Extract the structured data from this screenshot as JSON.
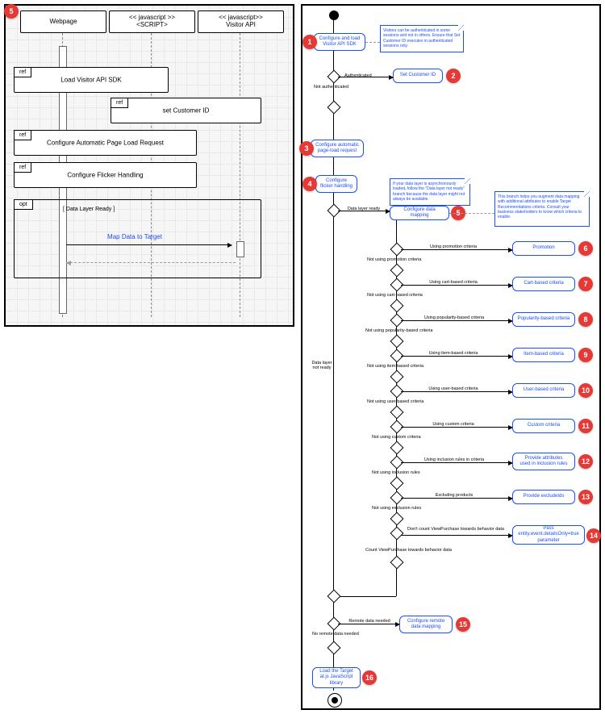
{
  "sequence": {
    "corner_marker": "5",
    "lanes": {
      "webpage": "Webpage",
      "script": "<< javascript >>\n<SCRIPT>",
      "visitor": "<< javascript>>\nVisitor API"
    },
    "frag_ref1": "ref",
    "frag_ref1_label": "Load Visitor API SDK",
    "frag_ref2": "ref",
    "frag_ref2_label": "set Customer ID",
    "frag_ref3": "ref",
    "frag_ref3_label": "Configure Automatic Page Load Request",
    "frag_ref4": "ref",
    "frag_ref4_label": "Configure Flicker Handling",
    "frag_opt": "opt",
    "frag_opt_guard": "[ Data Layer Ready ]",
    "frag_opt_link": "Map Data to Target"
  },
  "flow": {
    "markers": {
      "m1": "1",
      "m2": "2",
      "m3": "3",
      "m4": "4",
      "m5": "5",
      "m6": "6",
      "m7": "7",
      "m8": "8",
      "m9": "9",
      "m10": "10",
      "m11": "11",
      "m12": "12",
      "m13": "13",
      "m14": "14",
      "m15": "15",
      "m16": "16"
    },
    "nodes": {
      "n1": "Configure and load\nVisitor API SDK",
      "n2": "Set Customer ID",
      "n3": "Configure automatic\npage-load request",
      "n4": "Configure\nflicker handling",
      "n5": "Configure data mapping",
      "n6": "Promotion",
      "n7": "Cart-based criteria",
      "n8": "Popularity-based criteria",
      "n9": "Item-based criteria",
      "n10": "User-based criteria",
      "n11": "Custom criteria",
      "n12": "Provide attributes\nused in inclusion rules",
      "n13": "Provide excludeIds",
      "n14": "Pass\nentity.event.detailsOnly=true\nparameter",
      "n15": "Configure remote\ndata mapping",
      "n16": "Load the Target\nat.js JavaScript\nlibrary"
    },
    "notes": {
      "noteA": "Visitors can be authenticated in some sessions and not in others. Ensure that Set Customer ID executes in authenticated sessions only.",
      "noteB": "If your data layer is asynchronously loaded, follow the \"Data layer not ready\" branch because the data layer might not always be available.",
      "noteC": "This branch helps you augment data mapping with additional attributes to enable Target Recommendations criteria. Consult your business stakeholders to know which criteria to enable."
    },
    "labels": {
      "auth": "Authenticated",
      "notauth": "Not authenticated",
      "dlr": "Data layer ready",
      "dlnr": "Data layer\nnot ready",
      "l6yes": "Using promotion criteria",
      "l6no": "Not using promotion criteria",
      "l7yes": "Using cart-based criteria",
      "l7no": "Not using cart-based criteria",
      "l8yes": "Using popularity-based criteria",
      "l8no": "Not using popularity-based criteria",
      "l9yes": "Using item-based criteria",
      "l9no": "Not using item-based criteria",
      "l10yes": "Using user-based criteria",
      "l10no": "Not using user-based criteria",
      "l11yes": "Using custom criteria",
      "l11no": "Not using custom criteria",
      "l12yes": "Using inclusion rules in criteria",
      "l12no": "Not using inclusion rules",
      "l13yes": "Excluding products",
      "l13no": "Not using exclusion rules",
      "l14yes": "Don't count ViewPurchase towards behavior data",
      "l14no": "Count ViewPurchase towards behavior data",
      "l15yes": "Remote data needed",
      "l15no": "No remote data needed"
    }
  }
}
